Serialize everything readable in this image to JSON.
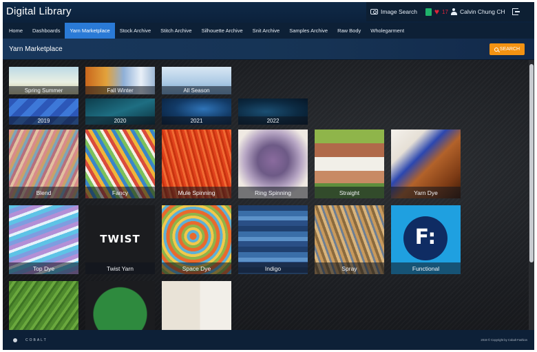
{
  "app": {
    "title": "Digital Library"
  },
  "topbar": {
    "image_search": "Image Search",
    "fav_count": "17",
    "user_name": "Calvin Chung CH"
  },
  "nav": {
    "items": [
      "Home",
      "Dashboards",
      "Yarn Marketplace",
      "Stock Archive",
      "Stitch Archive",
      "Silhouette Archive",
      "Snit Archive",
      "Samples Archive",
      "Raw Body",
      "Wholegarment"
    ],
    "active": "Yarn Marketplace"
  },
  "page": {
    "title": "Yarn Marketplace",
    "search_label": "SEARCH"
  },
  "season_tiles": [
    "Spring Summer",
    "Fall Winter",
    "All Season"
  ],
  "year_tiles": [
    "2019",
    "2020",
    "2021",
    "2022"
  ],
  "yarn_row1": [
    "Blend",
    "Fancy",
    "Mule Spinning",
    "Ring Spinning",
    "Straight",
    "Yarn Dye"
  ],
  "yarn_row2": [
    "Top Dye",
    "Twist Yarn",
    "Space Dye",
    "Indigo",
    "Spray",
    "Functional"
  ],
  "twist_logo": "TWIST",
  "functional_logo": "F:",
  "footer": {
    "brand": "COBALT",
    "copyright": "2019 © Copyright by Cobalt Fashion"
  },
  "colors": {
    "nav_active": "#2a7ad6",
    "search_button": "#f39212",
    "header_bg": "#0d2036"
  }
}
